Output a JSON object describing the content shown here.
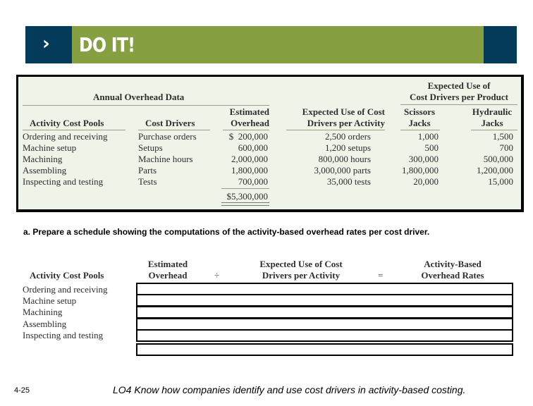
{
  "banner": {
    "icon": "chevron-right-icon",
    "chevron": "›",
    "title": "DO IT!",
    "colors": {
      "green": "#869f40",
      "navy": "#053b5a"
    }
  },
  "data_table": {
    "group_left": "Annual Overhead Data",
    "group_right": [
      "Expected Use of",
      "Cost Drivers per Product"
    ],
    "headers": {
      "pool": "Activity Cost Pools",
      "driver": "Cost Drivers",
      "overhead": [
        "Estimated",
        "Overhead"
      ],
      "expected": [
        "Expected Use of Cost",
        "Drivers per Activity"
      ],
      "scissors": [
        "Scissors",
        "Jacks"
      ],
      "hydraulic": [
        "Hydraulic",
        "Jacks"
      ]
    },
    "rows": [
      {
        "pool": "Ordering and receiving",
        "driver": "Purchase orders",
        "overhead": "$  200,000",
        "expected": "2,500 orders",
        "scissors": "1,000",
        "hydraulic": "1,500"
      },
      {
        "pool": "Machine setup",
        "driver": "Setups",
        "overhead": "600,000",
        "expected": "1,200 setups",
        "scissors": "500",
        "hydraulic": "700"
      },
      {
        "pool": "Machining",
        "driver": "Machine hours",
        "overhead": "2,000,000",
        "expected": "800,000 hours",
        "scissors": "300,000",
        "hydraulic": "500,000"
      },
      {
        "pool": "Assembling",
        "driver": "Parts",
        "overhead": "1,800,000",
        "expected": "3,000,000 parts",
        "scissors": "1,800,000",
        "hydraulic": "1,200,000"
      },
      {
        "pool": "Inspecting and testing",
        "driver": "Tests",
        "overhead": "700,000",
        "expected": "35,000 tests",
        "scissors": "20,000",
        "hydraulic": "15,000"
      }
    ],
    "total": "$5,300,000"
  },
  "prompt": "a.  Prepare a schedule showing the computations of the activity-based overhead rates per cost driver.",
  "schedule": {
    "headers": {
      "pool": "Activity Cost Pools",
      "overhead": [
        "Estimated",
        "Overhead"
      ],
      "divide": "÷",
      "expected": [
        "Expected Use of Cost",
        "Drivers per Activity"
      ],
      "equals": "=",
      "rate": [
        "Activity-Based",
        "Overhead Rates"
      ]
    },
    "pools": [
      "Ordering and receiving",
      "Machine setup",
      "Machining",
      "Assembling",
      "Inspecting and testing"
    ]
  },
  "footer": {
    "page": "4-25",
    "objective": "LO4  Know how companies identify and use cost drivers in activity-based costing."
  }
}
